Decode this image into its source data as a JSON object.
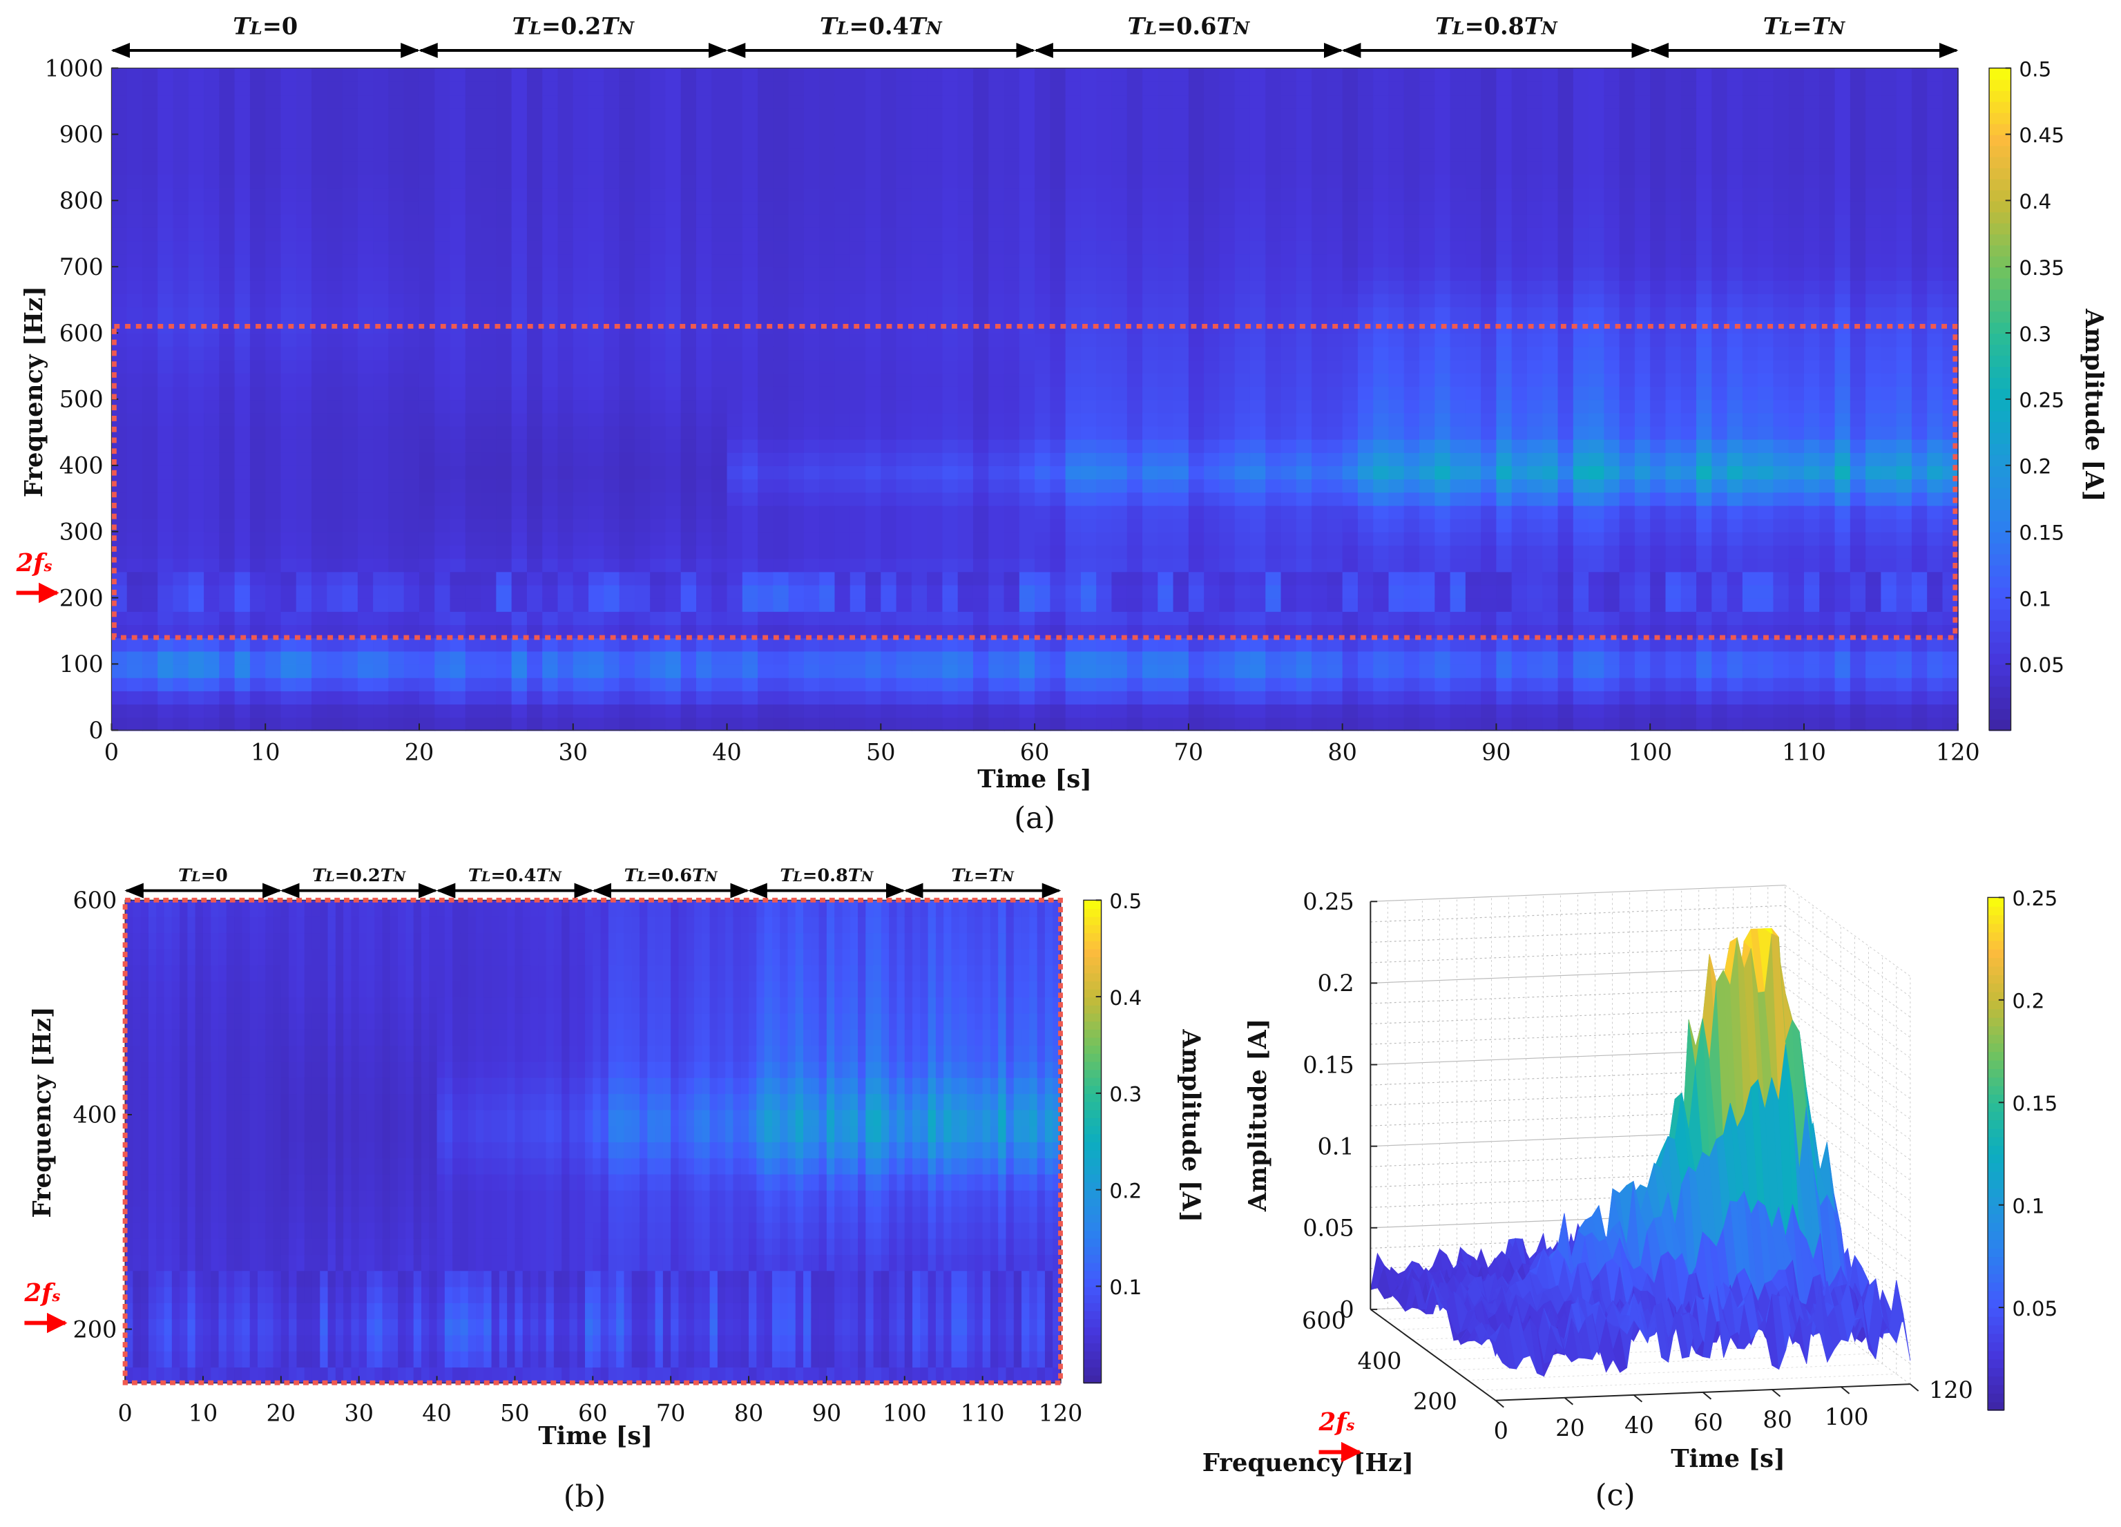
{
  "colors": {
    "highlight_box": "#f05a50",
    "marker": "#ff0000",
    "colormap": [
      "#3e26a8",
      "#4636dc",
      "#4259fc",
      "#2d7ff0",
      "#1f98da",
      "#0cadc0",
      "#2bbc95",
      "#72c25e",
      "#c3bb3a",
      "#fcbb3d",
      "#f9fb0e"
    ]
  },
  "load_segments": [
    {
      "pre": "T",
      "sub": "L",
      "val": "=0",
      "post": "",
      "post_sub": ""
    },
    {
      "pre": "T",
      "sub": "L",
      "val": "=0.2",
      "post": "T",
      "post_sub": "N"
    },
    {
      "pre": "T",
      "sub": "L",
      "val": "=0.4",
      "post": "T",
      "post_sub": "N"
    },
    {
      "pre": "T",
      "sub": "L",
      "val": "=0.6",
      "post": "T",
      "post_sub": "N"
    },
    {
      "pre": "T",
      "sub": "L",
      "val": "=0.8",
      "post": "T",
      "post_sub": "N"
    },
    {
      "pre": "T",
      "sub": "L",
      "val": "=",
      "post": "T",
      "post_sub": "N"
    }
  ],
  "marker": {
    "label_main": "2f",
    "label_sub": "s",
    "frequency": 200
  },
  "chart_data": [
    {
      "id": "a",
      "type": "heatmap",
      "caption": "(a)",
      "xlabel": "Time [s]",
      "ylabel": "Frequency [Hz]",
      "colorbar_label": "Amplitude [A]",
      "xlim": [
        0,
        120
      ],
      "ylim": [
        0,
        1000
      ],
      "clim": [
        0,
        0.5
      ],
      "xticks": [
        "0",
        "10",
        "20",
        "30",
        "40",
        "50",
        "60",
        "70",
        "80",
        "90",
        "100",
        "110",
        "120"
      ],
      "yticks": [
        "0",
        "100",
        "200",
        "300",
        "400",
        "500",
        "600",
        "700",
        "800",
        "900",
        "1000"
      ],
      "cticks": [
        "0.05",
        "0.1",
        "0.15",
        "0.2",
        "0.25",
        "0.3",
        "0.35",
        "0.4",
        "0.45",
        "0.5"
      ],
      "highlight_region": {
        "freq": [
          140,
          610
        ],
        "time": [
          0,
          120
        ]
      },
      "segment_times": [
        0,
        20,
        40,
        60,
        80,
        100,
        120
      ],
      "freq_bands": [
        25,
        50,
        100,
        150,
        200,
        260,
        330,
        390,
        450,
        520,
        620,
        700,
        850,
        980
      ],
      "amplitude_by_segment": [
        [
          0.03,
          0.06,
          0.16,
          0.05,
          0.07,
          0.045,
          0.04,
          0.04,
          0.04,
          0.045,
          0.06,
          0.05,
          0.04,
          0.04
        ],
        [
          0.03,
          0.07,
          0.14,
          0.05,
          0.08,
          0.045,
          0.035,
          0.03,
          0.035,
          0.045,
          0.05,
          0.045,
          0.04,
          0.04
        ],
        [
          0.03,
          0.07,
          0.14,
          0.05,
          0.09,
          0.05,
          0.05,
          0.08,
          0.05,
          0.045,
          0.05,
          0.045,
          0.04,
          0.04
        ],
        [
          0.03,
          0.07,
          0.14,
          0.05,
          0.085,
          0.06,
          0.07,
          0.13,
          0.08,
          0.07,
          0.06,
          0.05,
          0.04,
          0.04
        ],
        [
          0.03,
          0.06,
          0.12,
          0.05,
          0.075,
          0.06,
          0.09,
          0.2,
          0.12,
          0.1,
          0.08,
          0.05,
          0.04,
          0.04
        ],
        [
          0.03,
          0.06,
          0.12,
          0.05,
          0.075,
          0.06,
          0.09,
          0.21,
          0.12,
          0.1,
          0.08,
          0.05,
          0.04,
          0.04
        ]
      ]
    },
    {
      "id": "b",
      "type": "heatmap",
      "caption": "(b)",
      "xlabel": "Time [s]",
      "ylabel": "Frequency [Hz]",
      "colorbar_label": "Amplitude [A]",
      "xlim": [
        0,
        120
      ],
      "ylim": [
        150,
        600
      ],
      "clim": [
        0,
        0.5
      ],
      "xticks": [
        "0",
        "10",
        "20",
        "30",
        "40",
        "50",
        "60",
        "70",
        "80",
        "90",
        "100",
        "110",
        "120"
      ],
      "yticks": [
        "200",
        "400",
        "600"
      ],
      "cticks": [
        "0.1",
        "0.2",
        "0.3",
        "0.4",
        "0.5"
      ]
    },
    {
      "id": "c",
      "type": "surface",
      "caption": "(c)",
      "xlabel": "Time [s]",
      "ylabel": "Frequency [Hz]",
      "zlabel": "Amplitude [A]",
      "xlim": [
        0,
        120
      ],
      "ylim": [
        150,
        600
      ],
      "zlim": [
        0,
        0.25
      ],
      "clim": [
        0,
        0.25
      ],
      "xticks": [
        "0",
        "20",
        "40",
        "60",
        "80",
        "100",
        "120"
      ],
      "yticks": [
        "200",
        "400",
        "600"
      ],
      "zticks": [
        "0",
        "0.05",
        "0.1",
        "0.15",
        "0.2",
        "0.25"
      ],
      "cticks": [
        "0.05",
        "0.1",
        "0.15",
        "0.2",
        "0.25"
      ],
      "peak_amplitude_by_time": {
        "t": [
          0,
          10,
          20,
          30,
          40,
          50,
          60,
          70,
          80,
          90,
          100,
          110,
          120
        ],
        "a": [
          0.03,
          0.03,
          0.03,
          0.035,
          0.05,
          0.06,
          0.08,
          0.12,
          0.19,
          0.22,
          0.24,
          0.13,
          0.04
        ]
      }
    }
  ]
}
